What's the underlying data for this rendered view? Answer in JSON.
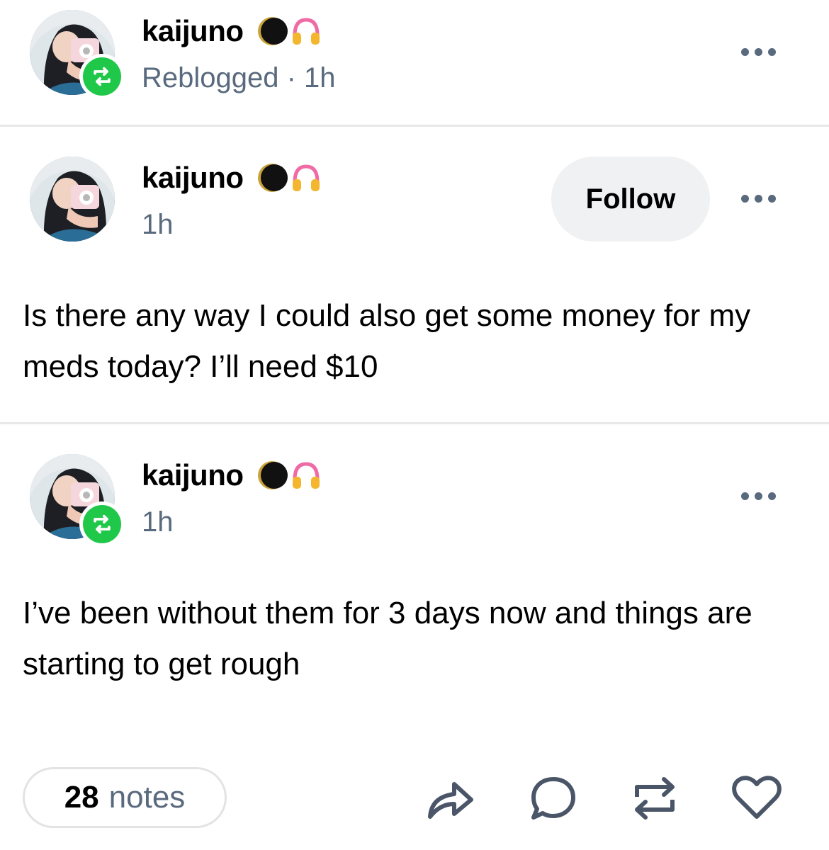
{
  "reblog_header": {
    "username": "kaijuno",
    "status_line": "Reblogged · 1h",
    "emoji": [
      "new-moon-icon",
      "headphones-icon"
    ]
  },
  "posts": [
    {
      "username": "kaijuno",
      "time": "1h",
      "follow_label": "Follow",
      "text": "Is there any way I could also get some money for my meds today? I’ll need $10"
    },
    {
      "username": "kaijuno",
      "time": "1h",
      "text": "I’ve been without them for 3 days now and things are starting to get rough"
    }
  ],
  "footer": {
    "notes_count": "28",
    "notes_label": "notes",
    "actions": [
      "share-icon",
      "reply-icon",
      "reblog-icon",
      "like-icon"
    ]
  },
  "colors": {
    "reblog_green": "#20c84a",
    "muted_text": "#5a6a7e",
    "button_bg": "#f0f1f3",
    "divider": "#e8e8e8"
  }
}
